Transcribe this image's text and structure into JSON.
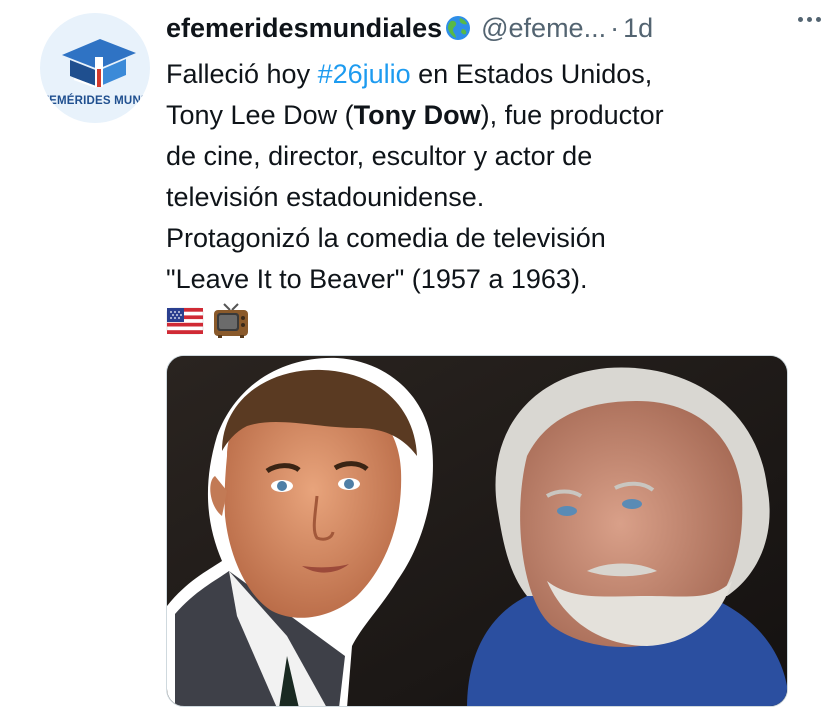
{
  "tweet": {
    "avatar_label": "EFEMÉRIDES MUNDIAL",
    "display_name": "efemeridesmundiales",
    "handle": "@efeme...",
    "separator": "·",
    "time": "1d",
    "text": {
      "l1_pre": "Falleció hoy ",
      "l1_hashtag": "#26julio",
      "l1_post": " en Estados Unidos,",
      "l2_pre": "Tony Lee Dow (",
      "l2_bold": "Tony Dow",
      "l2_post": "), fue productor",
      "l3": "de cine, director, escultor y actor de",
      "l4": "televisión estadounidense.",
      "l5": "Protagonizó la comedia de televisión",
      "l6": "\"Leave It to Beaver\" (1957 a 1963)."
    },
    "emojis": [
      "us-flag-icon",
      "television-icon"
    ],
    "colors": {
      "hashtag": "#1d9bf0",
      "secondary": "#536471",
      "primary": "#0f1419"
    }
  }
}
